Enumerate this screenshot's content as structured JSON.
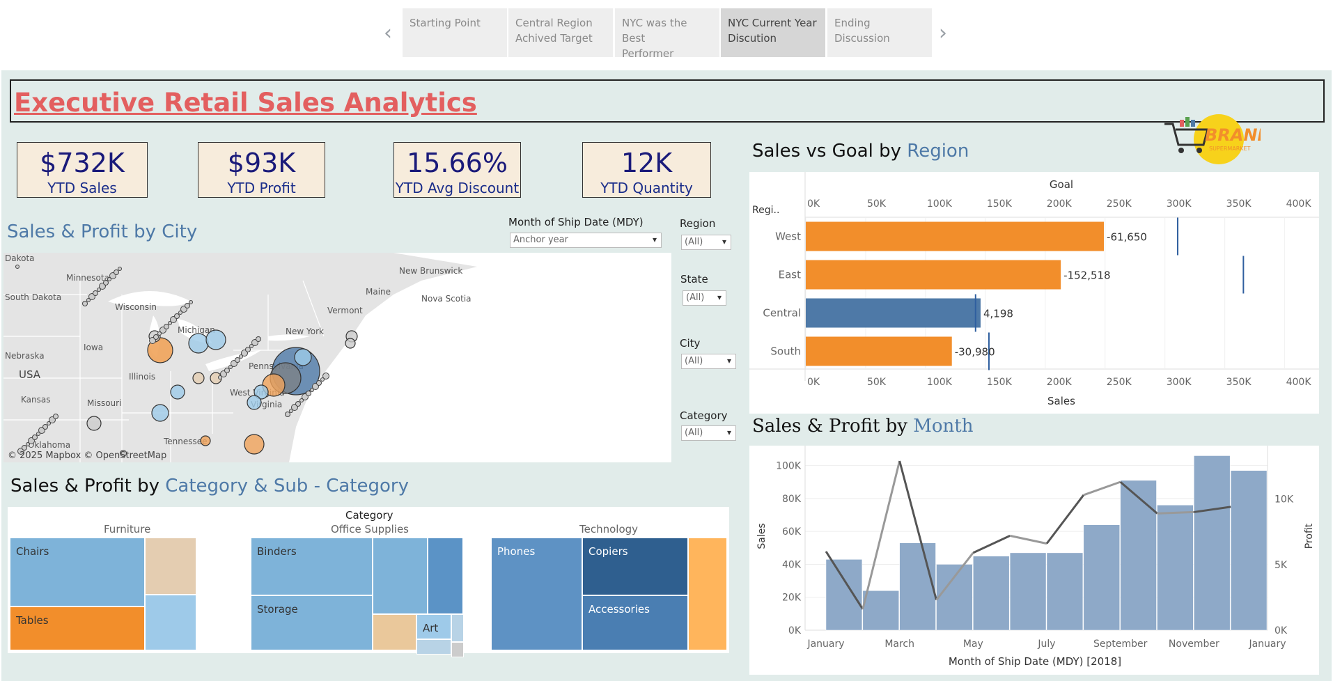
{
  "story": {
    "tabs": [
      {
        "label1": "Starting Point",
        "label2": ""
      },
      {
        "label1": "Central Region",
        "label2": "Achived Target"
      },
      {
        "label1": "NYC was the Best",
        "label2": "Performer"
      },
      {
        "label1": "NYC  Current Year",
        "label2": "Discution"
      },
      {
        "label1": "Ending Discussion",
        "label2": ""
      }
    ],
    "prev_icon": "chevron-left-icon",
    "next_icon": "chevron-right-icon"
  },
  "title": "Executive Retail Sales Analytics",
  "logo": {
    "text": "BRAND",
    "sub": "SUPERMARKET"
  },
  "kpis": [
    {
      "value": "$732K",
      "label": "YTD Sales"
    },
    {
      "value": "$93K",
      "label": "YTD Profit"
    },
    {
      "value": "15.66%",
      "label": "YTD Avg Discount"
    },
    {
      "value": "12K",
      "label": "YTD Quantity"
    }
  ],
  "city_section": {
    "title_prefix": "Sales & Profit by ",
    "title_highlight": "City",
    "month_filter_label": "Month of Ship Date (MDY)",
    "month_filter_value": "Anchor year",
    "map_credit": "© 2025 Mapbox © OpenStreetMap",
    "map_labels": [
      "Dakota",
      "Minnesota",
      "South Dakota",
      "Wisconsin",
      "Michigan",
      "Iowa",
      "Nebraska",
      "USA",
      "Illinois",
      "Kansas",
      "Missouri",
      "Oklahoma",
      "Pennsylvania",
      "West Virginia",
      "Virginia",
      "New York",
      "Vermont",
      "Maine",
      "New Brunswick",
      "Nova Scotia",
      "Tennessee"
    ]
  },
  "filters": [
    {
      "label": "Region",
      "value": "(All)"
    },
    {
      "label": "State",
      "value": "(All)"
    },
    {
      "label": "City",
      "value": "(All)"
    },
    {
      "label": "Category",
      "value": "(All)"
    }
  ],
  "region_chart": {
    "title_prefix": "Sales vs  Goal by ",
    "title_highlight": "Region",
    "top_axis_title": "Goal",
    "bottom_axis_title": "Sales",
    "row_header": "Regi..",
    "ticks": [
      "0K",
      "50K",
      "100K",
      "150K",
      "200K",
      "250K",
      "300K",
      "350K",
      "400K"
    ]
  },
  "category_section": {
    "title_prefix": "Sales & Profit by ",
    "title_highlight": "Category & Sub - Category",
    "header": "Category",
    "categories": [
      "Furniture",
      "Office Supplies",
      "Technology"
    ],
    "cells": {
      "chairs": "Chairs",
      "tables": "Tables",
      "binders": "Binders",
      "storage": "Storage",
      "art": "Art",
      "phones": "Phones",
      "copiers": "Copiers",
      "accessories": "Accessories"
    }
  },
  "month_chart_titles": {
    "title_prefix": "Sales & Profit by ",
    "title_highlight": "Month"
  },
  "chart_data": [
    {
      "type": "bar",
      "orientation": "horizontal",
      "categories": [
        "West",
        "East",
        "Central",
        "South"
      ],
      "series": [
        {
          "name": "Sales",
          "values": [
            249000,
            213000,
            146000,
            122000
          ]
        },
        {
          "name": "Goal",
          "values": [
            310650,
            365518,
            141802,
            152980
          ]
        }
      ],
      "data_labels": [
        "-61,650",
        "-152,518",
        "4,198",
        "-30,980"
      ],
      "bar_colors": [
        "#f28e2b",
        "#f28e2b",
        "#4e79a7",
        "#f28e2b"
      ],
      "xlim": [
        0,
        420000
      ],
      "xlabel": "Sales",
      "x2label": "Goal",
      "ylabel": "Regi..",
      "grid": true
    },
    {
      "type": "bar",
      "categories": [
        "January",
        "February",
        "March",
        "April",
        "May",
        "June",
        "July",
        "August",
        "September",
        "October",
        "November",
        "December"
      ],
      "series": [
        {
          "name": "Sales",
          "type": "bar",
          "values": [
            43000,
            24000,
            53000,
            40000,
            45000,
            47000,
            47000,
            64000,
            91000,
            76000,
            106000,
            97000
          ]
        },
        {
          "name": "Profit",
          "type": "line",
          "values": [
            6000,
            1600,
            12900,
            2300,
            5900,
            7200,
            6600,
            10300,
            11300,
            8900,
            9000,
            9400
          ]
        }
      ],
      "x_tick_labels": [
        "January",
        "March",
        "May",
        "July",
        "September",
        "November",
        "January"
      ],
      "y_ticks": [
        "0K",
        "20K",
        "40K",
        "60K",
        "80K",
        "100K"
      ],
      "y2_ticks": [
        "0K",
        "5K",
        "10K"
      ],
      "ylim": [
        0,
        110000
      ],
      "y2lim": [
        0,
        13800
      ],
      "xlabel": "Month of Ship Date (MDY) [2018]",
      "ylabel": "Sales",
      "y2label": "Profit",
      "grid": true,
      "colors": {
        "bars": "#8ea9c8",
        "line": "#555555"
      }
    }
  ],
  "colors": {
    "accent_blue": "#4e79a7",
    "accent_orange": "#f28e2b",
    "title_red": "#e35f5f",
    "kpi_bg": "#f7ecdc",
    "dashboard_bg": "#e1ecea"
  }
}
